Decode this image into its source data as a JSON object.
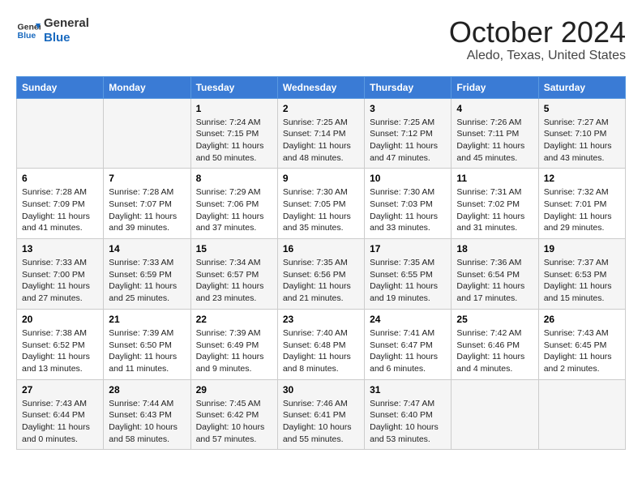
{
  "header": {
    "logo_line1": "General",
    "logo_line2": "Blue",
    "month": "October 2024",
    "location": "Aledo, Texas, United States"
  },
  "weekdays": [
    "Sunday",
    "Monday",
    "Tuesday",
    "Wednesday",
    "Thursday",
    "Friday",
    "Saturday"
  ],
  "weeks": [
    [
      {
        "day": "",
        "info": ""
      },
      {
        "day": "",
        "info": ""
      },
      {
        "day": "1",
        "info": "Sunrise: 7:24 AM\nSunset: 7:15 PM\nDaylight: 11 hours and 50 minutes."
      },
      {
        "day": "2",
        "info": "Sunrise: 7:25 AM\nSunset: 7:14 PM\nDaylight: 11 hours and 48 minutes."
      },
      {
        "day": "3",
        "info": "Sunrise: 7:25 AM\nSunset: 7:12 PM\nDaylight: 11 hours and 47 minutes."
      },
      {
        "day": "4",
        "info": "Sunrise: 7:26 AM\nSunset: 7:11 PM\nDaylight: 11 hours and 45 minutes."
      },
      {
        "day": "5",
        "info": "Sunrise: 7:27 AM\nSunset: 7:10 PM\nDaylight: 11 hours and 43 minutes."
      }
    ],
    [
      {
        "day": "6",
        "info": "Sunrise: 7:28 AM\nSunset: 7:09 PM\nDaylight: 11 hours and 41 minutes."
      },
      {
        "day": "7",
        "info": "Sunrise: 7:28 AM\nSunset: 7:07 PM\nDaylight: 11 hours and 39 minutes."
      },
      {
        "day": "8",
        "info": "Sunrise: 7:29 AM\nSunset: 7:06 PM\nDaylight: 11 hours and 37 minutes."
      },
      {
        "day": "9",
        "info": "Sunrise: 7:30 AM\nSunset: 7:05 PM\nDaylight: 11 hours and 35 minutes."
      },
      {
        "day": "10",
        "info": "Sunrise: 7:30 AM\nSunset: 7:03 PM\nDaylight: 11 hours and 33 minutes."
      },
      {
        "day": "11",
        "info": "Sunrise: 7:31 AM\nSunset: 7:02 PM\nDaylight: 11 hours and 31 minutes."
      },
      {
        "day": "12",
        "info": "Sunrise: 7:32 AM\nSunset: 7:01 PM\nDaylight: 11 hours and 29 minutes."
      }
    ],
    [
      {
        "day": "13",
        "info": "Sunrise: 7:33 AM\nSunset: 7:00 PM\nDaylight: 11 hours and 27 minutes."
      },
      {
        "day": "14",
        "info": "Sunrise: 7:33 AM\nSunset: 6:59 PM\nDaylight: 11 hours and 25 minutes."
      },
      {
        "day": "15",
        "info": "Sunrise: 7:34 AM\nSunset: 6:57 PM\nDaylight: 11 hours and 23 minutes."
      },
      {
        "day": "16",
        "info": "Sunrise: 7:35 AM\nSunset: 6:56 PM\nDaylight: 11 hours and 21 minutes."
      },
      {
        "day": "17",
        "info": "Sunrise: 7:35 AM\nSunset: 6:55 PM\nDaylight: 11 hours and 19 minutes."
      },
      {
        "day": "18",
        "info": "Sunrise: 7:36 AM\nSunset: 6:54 PM\nDaylight: 11 hours and 17 minutes."
      },
      {
        "day": "19",
        "info": "Sunrise: 7:37 AM\nSunset: 6:53 PM\nDaylight: 11 hours and 15 minutes."
      }
    ],
    [
      {
        "day": "20",
        "info": "Sunrise: 7:38 AM\nSunset: 6:52 PM\nDaylight: 11 hours and 13 minutes."
      },
      {
        "day": "21",
        "info": "Sunrise: 7:39 AM\nSunset: 6:50 PM\nDaylight: 11 hours and 11 minutes."
      },
      {
        "day": "22",
        "info": "Sunrise: 7:39 AM\nSunset: 6:49 PM\nDaylight: 11 hours and 9 minutes."
      },
      {
        "day": "23",
        "info": "Sunrise: 7:40 AM\nSunset: 6:48 PM\nDaylight: 11 hours and 8 minutes."
      },
      {
        "day": "24",
        "info": "Sunrise: 7:41 AM\nSunset: 6:47 PM\nDaylight: 11 hours and 6 minutes."
      },
      {
        "day": "25",
        "info": "Sunrise: 7:42 AM\nSunset: 6:46 PM\nDaylight: 11 hours and 4 minutes."
      },
      {
        "day": "26",
        "info": "Sunrise: 7:43 AM\nSunset: 6:45 PM\nDaylight: 11 hours and 2 minutes."
      }
    ],
    [
      {
        "day": "27",
        "info": "Sunrise: 7:43 AM\nSunset: 6:44 PM\nDaylight: 11 hours and 0 minutes."
      },
      {
        "day": "28",
        "info": "Sunrise: 7:44 AM\nSunset: 6:43 PM\nDaylight: 10 hours and 58 minutes."
      },
      {
        "day": "29",
        "info": "Sunrise: 7:45 AM\nSunset: 6:42 PM\nDaylight: 10 hours and 57 minutes."
      },
      {
        "day": "30",
        "info": "Sunrise: 7:46 AM\nSunset: 6:41 PM\nDaylight: 10 hours and 55 minutes."
      },
      {
        "day": "31",
        "info": "Sunrise: 7:47 AM\nSunset: 6:40 PM\nDaylight: 10 hours and 53 minutes."
      },
      {
        "day": "",
        "info": ""
      },
      {
        "day": "",
        "info": ""
      }
    ]
  ]
}
